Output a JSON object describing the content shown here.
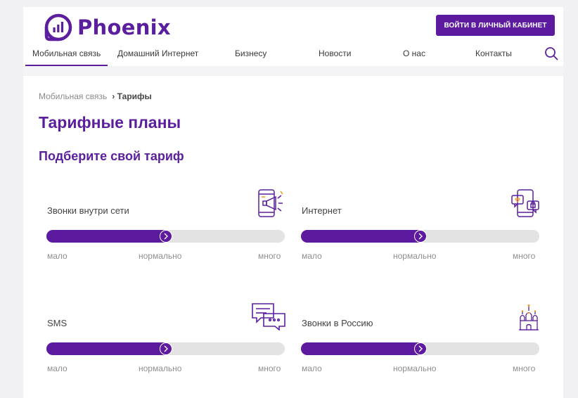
{
  "brand": {
    "name": "Phoenix",
    "color": "#5c1a9f"
  },
  "header": {
    "cabinet_button": "ВОЙТИ В ЛИЧНЫЙ КАБИНЕТ",
    "nav": [
      "Мобильная связь",
      "Домашний Интернет",
      "Бизнесу",
      "Новости",
      "О нас",
      "Контакты"
    ],
    "active_nav": "Мобильная связь",
    "search_icon": "search-icon"
  },
  "breadcrumb": {
    "parent": "Мобильная связь",
    "separator": "›",
    "current": "Тарифы"
  },
  "page_title": "Тарифные планы",
  "subtitle": "Подберите свой тариф",
  "scale_labels": {
    "low": "мало",
    "mid": "нормально",
    "high": "много"
  },
  "tariffs": [
    {
      "label": "Звонки внутри сети",
      "icon": "phone-megaphone-icon",
      "level": 0.5
    },
    {
      "label": "Интернет",
      "icon": "phone-messages-icon",
      "level": 0.5
    },
    {
      "label": "SMS",
      "icon": "chat-bubbles-icon",
      "level": 0.5
    },
    {
      "label": "Звонки в Россию",
      "icon": "kremlin-cathedral-icon",
      "level": 0.5
    }
  ]
}
